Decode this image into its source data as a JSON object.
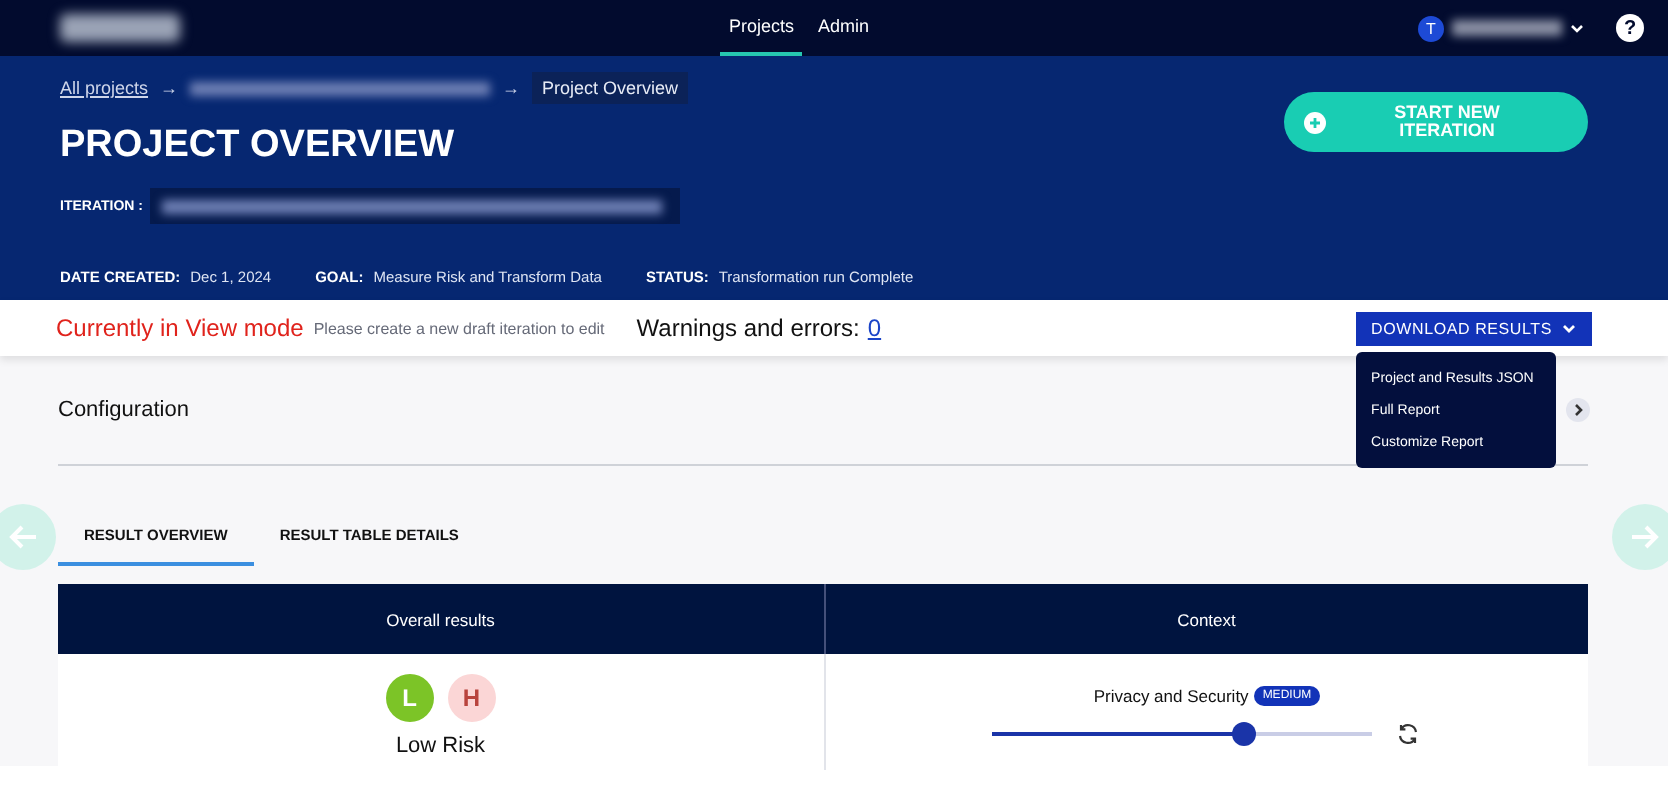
{
  "nav": {
    "tabs": [
      {
        "label": "Projects",
        "selected": true
      },
      {
        "label": "Admin",
        "selected": false
      }
    ],
    "avatar": "T",
    "help": "?"
  },
  "header": {
    "breadcrumb": {
      "root": "All projects",
      "separator": "→",
      "current": "Project Overview"
    },
    "title": "PROJECT OVERVIEW",
    "iteration_label": "ITERATION :",
    "start_button": "START NEW ITERATION",
    "meta": [
      {
        "label": "DATE CREATED:",
        "value": "Dec 1, 2024"
      },
      {
        "label": "GOAL:",
        "value": "Measure Risk and Transform Data"
      },
      {
        "label": "STATUS:",
        "value": "Transformation run Complete"
      }
    ]
  },
  "mode_bar": {
    "mode": "Currently in View mode",
    "hint": "Please create a new draft iteration to edit",
    "warnings_label": "Warnings and errors:",
    "warnings_count": "0",
    "download_button": "DOWNLOAD RESULTS"
  },
  "download_menu": {
    "open": true,
    "items": [
      "Project and Results JSON",
      "Full Report",
      "Customize Report"
    ]
  },
  "configuration": {
    "title": "Configuration"
  },
  "result_tabs": [
    {
      "label": "RESULT OVERVIEW",
      "selected": true
    },
    {
      "label": "RESULT TABLE DETAILS",
      "selected": false
    }
  ],
  "table": {
    "columns": [
      "Overall results",
      "Context"
    ],
    "risk_levels": [
      {
        "letter": "L",
        "selected": true,
        "color": "#7cc427"
      },
      {
        "letter": "H",
        "selected": false,
        "color": "#fbd6d6"
      }
    ],
    "risk_label": "Low Risk",
    "context": {
      "name": "Privacy and Security",
      "badge": "MEDIUM",
      "level": 0.66
    }
  }
}
